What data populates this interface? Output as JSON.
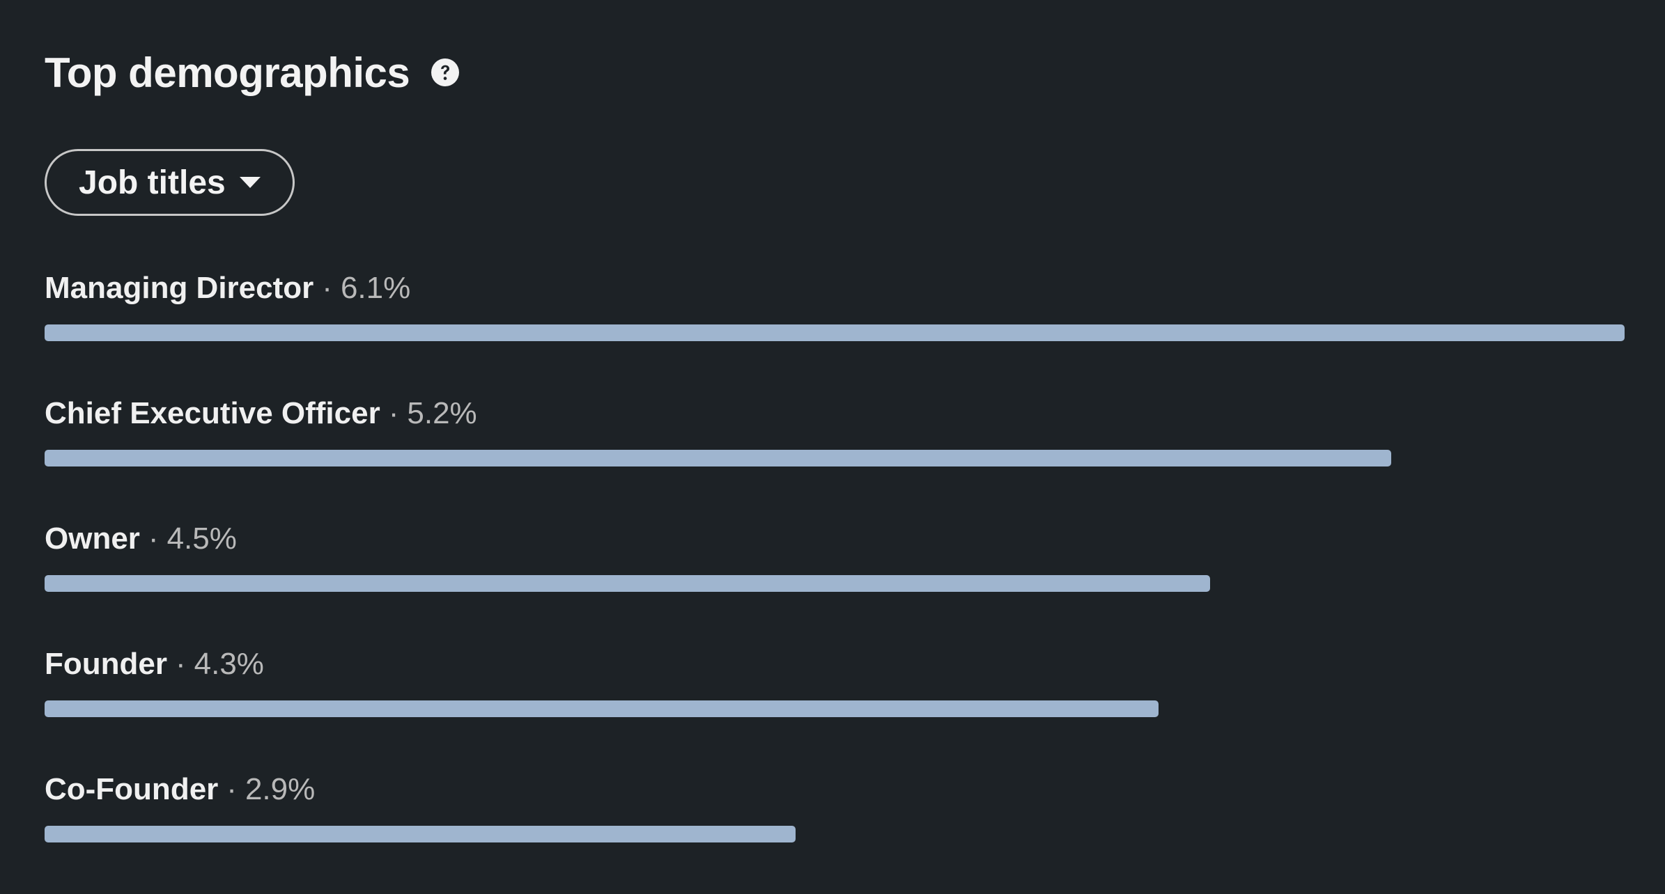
{
  "header": {
    "title": "Top demographics",
    "help_icon": "question-circle-icon"
  },
  "filter": {
    "selected": "Job titles",
    "caret_icon": "caret-down-icon"
  },
  "colors": {
    "background": "#1d2226",
    "bar": "#9fb5cf",
    "text": "#f0f0f0",
    "muted_text": "#b9b9b9"
  },
  "separator": "·",
  "rows": [
    {
      "label": "Managing Director",
      "percent": "6.1%",
      "value": 6.1
    },
    {
      "label": "Chief Executive Officer",
      "percent": "5.2%",
      "value": 5.2
    },
    {
      "label": "Owner",
      "percent": "4.5%",
      "value": 4.5
    },
    {
      "label": "Founder",
      "percent": "4.3%",
      "value": 4.3
    },
    {
      "label": "Co-Founder",
      "percent": "2.9%",
      "value": 2.9
    }
  ]
}
